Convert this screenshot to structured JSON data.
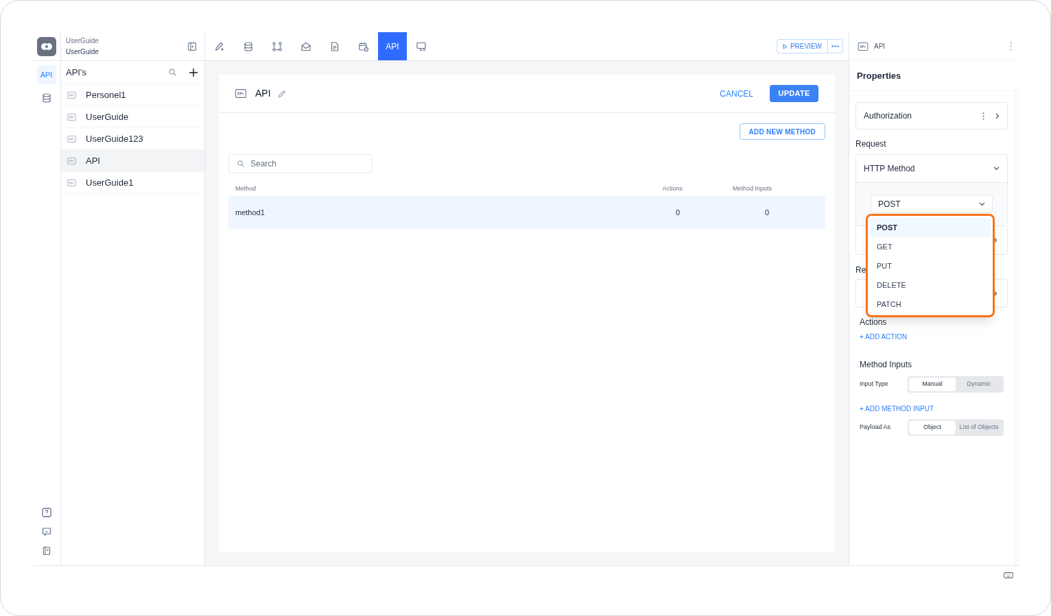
{
  "project": {
    "line_1": "UserGuide",
    "line_2": "UserGuide"
  },
  "rail": {
    "items": [
      {
        "kind": "text",
        "label": "API",
        "selected": true
      },
      {
        "kind": "database",
        "selected": false
      }
    ]
  },
  "toolbar": {
    "tabs": [
      {
        "kind": "pencil",
        "selected": false
      },
      {
        "kind": "database",
        "selected": false
      },
      {
        "kind": "nodes",
        "selected": false
      },
      {
        "kind": "mail",
        "selected": false
      },
      {
        "kind": "document",
        "selected": false
      },
      {
        "kind": "calendar",
        "selected": false
      },
      {
        "kind": "text",
        "label": "API",
        "selected": true
      },
      {
        "kind": "monitor",
        "selected": false
      }
    ],
    "preview": "PREVIEW"
  },
  "sidebar": {
    "title": "API's",
    "items": [
      {
        "label": "Personel1",
        "selected": false
      },
      {
        "label": "UserGuide",
        "selected": false
      },
      {
        "label": "UserGuide123",
        "selected": false
      },
      {
        "label": "API",
        "selected": true
      },
      {
        "label": "UserGuide1",
        "selected": false
      }
    ]
  },
  "editor": {
    "title": "API",
    "cancel": "CANCEL",
    "update": "UPDATE",
    "add_method": "ADD NEW METHOD",
    "search": {
      "placeholder": "Search"
    },
    "table": {
      "columns": [
        "Method",
        "Actions",
        "Method Inputs"
      ],
      "rows": [
        {
          "cells": [
            "method1",
            "0",
            "0"
          ],
          "selected": true
        }
      ]
    }
  },
  "properties": {
    "header": "API",
    "title": "Properties",
    "authorization": "Authorization",
    "request_heading": "Request",
    "http_method": {
      "label": "HTTP Method",
      "value": "POST",
      "options": [
        {
          "label": "POST",
          "selected": true
        },
        {
          "label": "GET",
          "selected": false
        },
        {
          "label": "PUT",
          "selected": false
        },
        {
          "label": "DELETE",
          "selected": false
        },
        {
          "label": "PATCH",
          "selected": false
        }
      ]
    },
    "response_heading": "Re",
    "actions_heading": "Actions",
    "add_action": "+ ADD ACTION",
    "method_inputs_heading": "Method Inputs",
    "input_type": {
      "label": "Input Type",
      "options": [
        {
          "label": "Manual",
          "selected": true
        },
        {
          "label": "Dynamic",
          "selected": false
        }
      ]
    },
    "add_method_input": "+ ADD METHOD INPUT",
    "payload_as": {
      "label": "Payload As",
      "options": [
        {
          "label": "Object",
          "selected": true
        },
        {
          "label": "List of Objects",
          "selected": false
        }
      ]
    }
  }
}
